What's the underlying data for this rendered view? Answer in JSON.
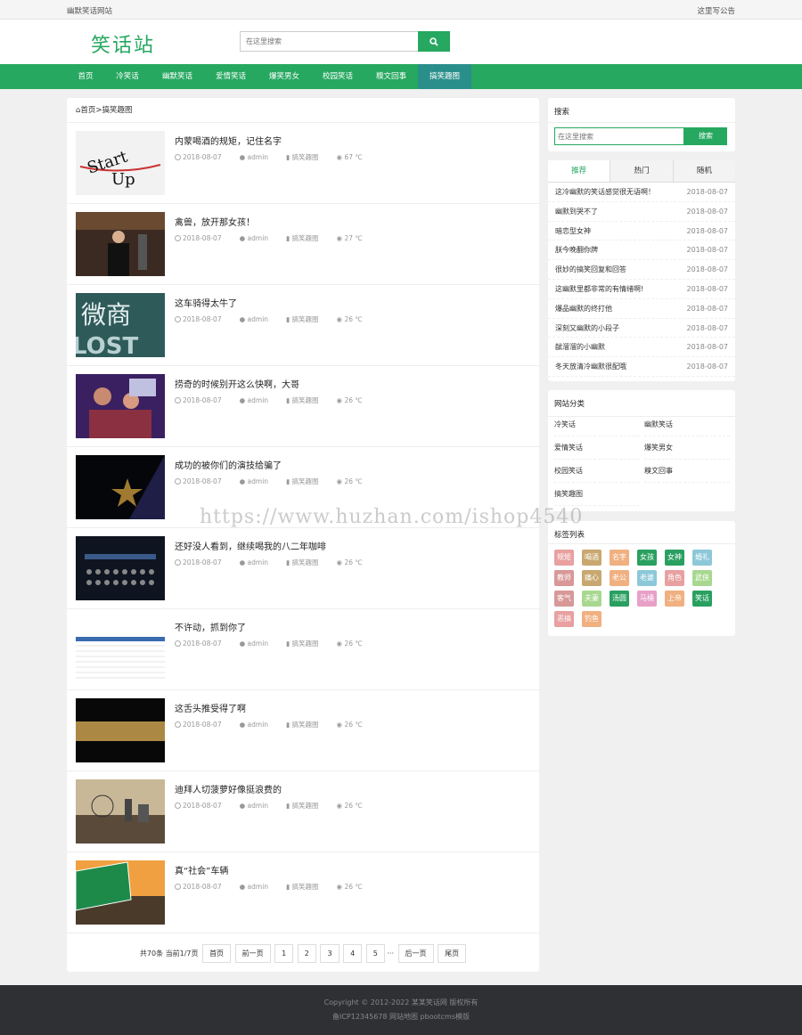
{
  "topbar": {
    "site_name": "幽默笑话网站",
    "notice": "这里写公告"
  },
  "header": {
    "logo": "笑话站",
    "search_placeholder": "在这里搜索",
    "search_icon": "search-icon"
  },
  "nav": [
    "首页",
    "冷笑话",
    "幽默笑话",
    "爱情笑话",
    "爆笑男女",
    "校园笑话",
    "糗文回事",
    "搞笑趣图"
  ],
  "breadcrumb": {
    "home": "首页",
    "sep": ">",
    "current": "搞笑趣图"
  },
  "posts": [
    {
      "title": "内蒙喝酒的规矩，记住名字",
      "date": "2018-08-07",
      "author": "admin",
      "category": "搞笑趣图",
      "views": "67 ℃"
    },
    {
      "title": "禽兽，放开那女孩！",
      "date": "2018-08-07",
      "author": "admin",
      "category": "搞笑趣图",
      "views": "27 ℃"
    },
    {
      "title": "这车骑得太牛了",
      "date": "2018-08-07",
      "author": "admin",
      "category": "搞笑趣图",
      "views": "26 ℃"
    },
    {
      "title": "捞奇的时候别开这么快啊，大哥",
      "date": "2018-08-07",
      "author": "admin",
      "category": "搞笑趣图",
      "views": "26 ℃"
    },
    {
      "title": "成功的被你们的演技给骗了",
      "date": "2018-08-07",
      "author": "admin",
      "category": "搞笑趣图",
      "views": "26 ℃"
    },
    {
      "title": "还好没人看到，继续喝我的八二年咖啡",
      "date": "2018-08-07",
      "author": "admin",
      "category": "搞笑趣图",
      "views": "26 ℃"
    },
    {
      "title": "不许动，抓到你了",
      "date": "2018-08-07",
      "author": "admin",
      "category": "搞笑趣图",
      "views": "26 ℃"
    },
    {
      "title": "这舌头推受得了啊",
      "date": "2018-08-07",
      "author": "admin",
      "category": "搞笑趣图",
      "views": "26 ℃"
    },
    {
      "title": "迪拜人切菠萝好像挺浪费的",
      "date": "2018-08-07",
      "author": "admin",
      "category": "搞笑趣图",
      "views": "26 ℃"
    },
    {
      "title": "真“社会”车辆",
      "date": "2018-08-07",
      "author": "admin",
      "category": "搞笑趣图",
      "views": "26 ℃"
    }
  ],
  "pagination": {
    "summary": "共70条 当前1/7页",
    "first": "首页",
    "prev": "前一页",
    "pages": [
      "1",
      "2",
      "3",
      "4",
      "5"
    ],
    "ellipsis": "···",
    "next": "后一页",
    "last": "尾页"
  },
  "sidebar": {
    "search": {
      "title": "搜索",
      "placeholder": "在这里搜索",
      "button": "搜索"
    },
    "tabs": [
      "推荐",
      "热门",
      "随机"
    ],
    "recommended": [
      {
        "title": "这冷幽默的笑话感觉很无语啊！",
        "date": "2018-08-07"
      },
      {
        "title": "幽默到哭不了",
        "date": "2018-08-07"
      },
      {
        "title": "暗恋型女神",
        "date": "2018-08-07"
      },
      {
        "title": "朕今晚翻你牌",
        "date": "2018-08-07"
      },
      {
        "title": "很妙的搞笑回复和回答",
        "date": "2018-08-07"
      },
      {
        "title": "这幽默里都非常的有情绪啊!",
        "date": "2018-08-07"
      },
      {
        "title": "爆品幽默的终打他",
        "date": "2018-08-07"
      },
      {
        "title": "深刻又幽默的小段子",
        "date": "2018-08-07"
      },
      {
        "title": "龇溜溜的小幽默",
        "date": "2018-08-07"
      },
      {
        "title": "冬天放清冷幽默很配哦",
        "date": "2018-08-07"
      }
    ],
    "categories": {
      "title": "网站分类",
      "items": [
        "冷笑话",
        "幽默笑话",
        "爱情笑话",
        "爆笑男女",
        "校园笑话",
        "糗文回事",
        "搞笑趣图"
      ]
    },
    "tags": {
      "title": "标签列表",
      "items": [
        {
          "label": "规矩",
          "color": "#e8a0a0"
        },
        {
          "label": "喝酒",
          "color": "#c8a870"
        },
        {
          "label": "名字",
          "color": "#f0b080"
        },
        {
          "label": "女孩",
          "color": "#2aa060"
        },
        {
          "label": "女神",
          "color": "#2aa060"
        },
        {
          "label": "婚礼",
          "color": "#8cc8d8"
        },
        {
          "label": "教师",
          "color": "#d89898"
        },
        {
          "label": "痛心",
          "color": "#c8a870"
        },
        {
          "label": "老公",
          "color": "#f0b080"
        },
        {
          "label": "老婆",
          "color": "#8cc8d8"
        },
        {
          "label": "角色",
          "color": "#e8a0a0"
        },
        {
          "label": "武侠",
          "color": "#a8d890"
        },
        {
          "label": "客气",
          "color": "#d89898"
        },
        {
          "label": "夫妻",
          "color": "#a8d890"
        },
        {
          "label": "汤圆",
          "color": "#2aa060"
        },
        {
          "label": "马桶",
          "color": "#e8a0c8"
        },
        {
          "label": "上帝",
          "color": "#f0b080"
        },
        {
          "label": "笑话",
          "color": "#2aa060"
        },
        {
          "label": "恶搞",
          "color": "#e8a0a0"
        },
        {
          "label": "钓鱼",
          "color": "#f0b080"
        }
      ]
    }
  },
  "watermark": "https://www.huzhan.com/ishop4540",
  "footer": {
    "line1": "Copyright © 2012-2022 某某笑话网 版权所有",
    "line2": "备ICP12345678 网站地图 pbootcms模版"
  }
}
